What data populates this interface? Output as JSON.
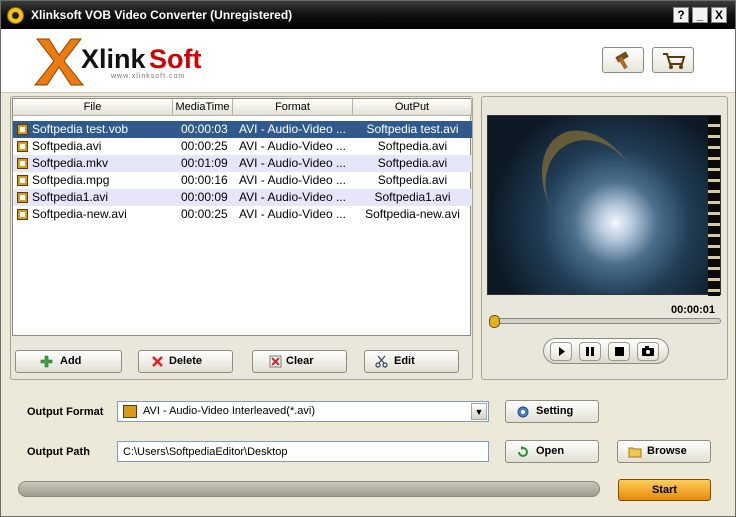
{
  "window": {
    "title": "Xlinksoft VOB Video Converter (Unregistered)",
    "help_label": "?",
    "minimize_label": "_",
    "close_label": "X"
  },
  "header": {
    "logo_text": "XlinkSoft",
    "logo_url_text": "www.xlinksoft.com",
    "buy_icon": "hammer-icon",
    "cart_icon": "cart-icon"
  },
  "file_list": {
    "columns": [
      "File",
      "MediaTime",
      "Format",
      "OutPut"
    ],
    "rows": [
      {
        "file": "Softpedia test.vob",
        "time": "00:00:03",
        "format": "AVI - Audio-Video ...",
        "output": "Softpedia test.avi"
      },
      {
        "file": "Softpedia.avi",
        "time": "00:00:25",
        "format": "AVI - Audio-Video ...",
        "output": "Softpedia.avi"
      },
      {
        "file": "Softpedia.mkv",
        "time": "00:01:09",
        "format": "AVI - Audio-Video ...",
        "output": "Softpedia.avi"
      },
      {
        "file": "Softpedia.mpg",
        "time": "00:00:16",
        "format": "AVI - Audio-Video ...",
        "output": "Softpedia.avi"
      },
      {
        "file": "Softpedia1.avi",
        "time": "00:00:09",
        "format": "AVI - Audio-Video ...",
        "output": "Softpedia1.avi"
      },
      {
        "file": "Softpedia-new.avi",
        "time": "00:00:25",
        "format": "AVI - Audio-Video ...",
        "output": "Softpedia-new.avi"
      }
    ],
    "selected_row": 0
  },
  "actions": {
    "add": "Add",
    "delete": "Delete",
    "clear": "Clear",
    "edit": "Edit"
  },
  "preview": {
    "time": "00:00:01",
    "seek_fraction": 0.0
  },
  "settings": {
    "output_format_label": "Output Format",
    "output_format_value": "AVI - Audio-Video Interleaved(*.avi)",
    "setting_button": "Setting",
    "output_path_label": "Output Path",
    "output_path_value": "C:\\Users\\SoftpediaEditor\\Desktop",
    "open_button": "Open",
    "browse_button": "Browse",
    "start_button": "Start",
    "progress": 0.0
  },
  "colors": {
    "selected_row": "#315a8c",
    "alt_row": "#e6e6fa",
    "accent_orange": "#f0a020"
  }
}
